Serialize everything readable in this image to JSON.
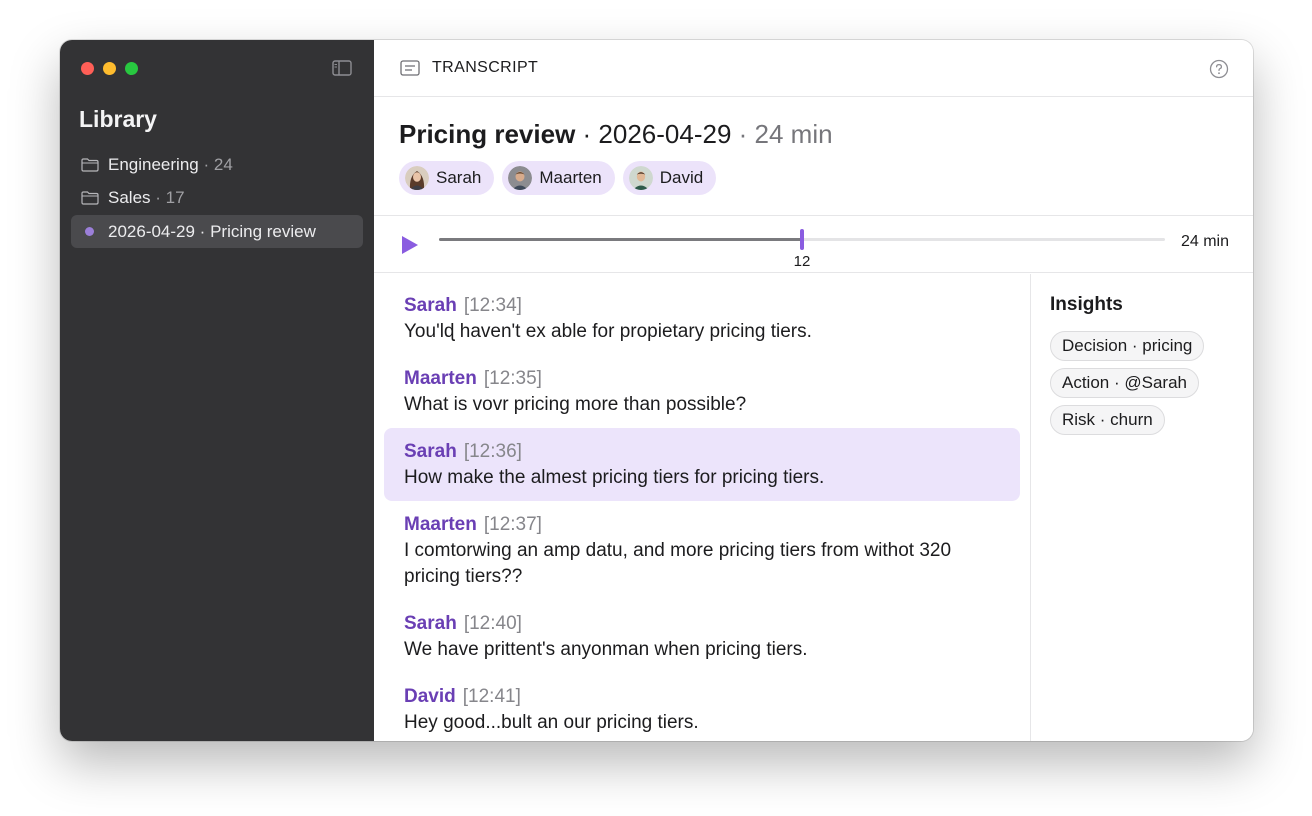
{
  "sidebar": {
    "title": "Library",
    "items": [
      {
        "label": "Engineering",
        "count": "· 24",
        "icon": "folder-icon"
      },
      {
        "label": "Sales",
        "count": "· 17",
        "icon": "folder-icon"
      },
      {
        "label": "2026-04-29 · Pricing review",
        "count": "",
        "icon": "dot-icon",
        "selected": true
      }
    ]
  },
  "topbar": {
    "label": "TRANSCRIPT",
    "help_icon": "help-circle-icon"
  },
  "header": {
    "name": "Pricing review",
    "date": " · 2026-04-29",
    "duration": " · 24 min",
    "participants": [
      "Sarah",
      "Maarten",
      "David"
    ]
  },
  "player": {
    "position_label": "12",
    "duration_label": "24 min",
    "progress": 0.5,
    "accent": "#8a5ce0"
  },
  "transcript": [
    {
      "speaker": "Sarah",
      "time": "[12:34]",
      "text": "You'lɖ haven't ex able for propietary pricing tiers."
    },
    {
      "speaker": "Maarten",
      "time": "[12:35]",
      "text": "What is vovr pricing more than possible?"
    },
    {
      "speaker": "Sarah",
      "time": "[12:36]",
      "text": "How make the almest pricing tiers for pricing tiers.",
      "active": true
    },
    {
      "speaker": "Maarten",
      "time": "[12:37]",
      "text": "I comtorwing an amp datu, and more pricing tiers from withot 320 pricing tiers??"
    },
    {
      "speaker": "Sarah",
      "time": "[12:40]",
      "text": "We have prittent's anyonman when pricing tiers."
    },
    {
      "speaker": "David",
      "time": "[12:41]",
      "text": "Hey good...bult an our pricing tiers."
    }
  ],
  "insights": {
    "title": "Insights",
    "tags": [
      "Decision · pricing",
      "Action · @Sarah",
      "Risk · churn"
    ]
  },
  "colors": {
    "accent": "#6a3fb4",
    "chip_bg": "#ece3fa",
    "sidebar_bg": "#333335"
  }
}
